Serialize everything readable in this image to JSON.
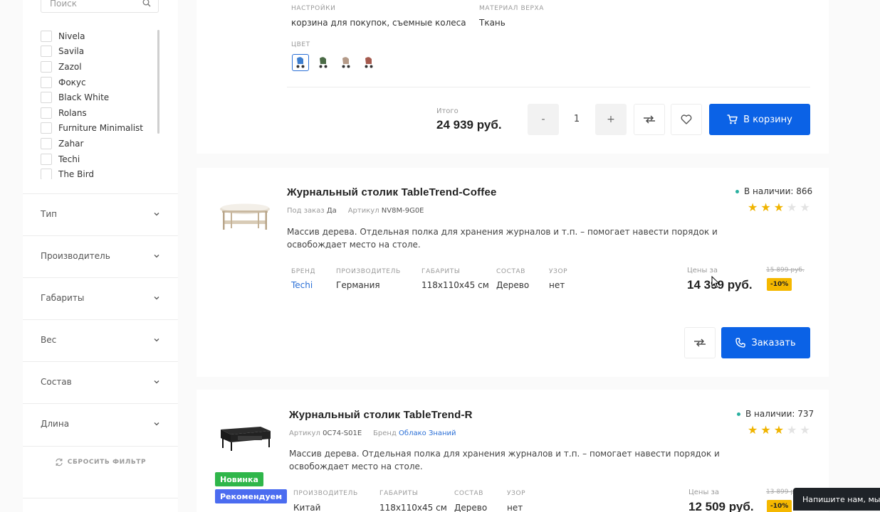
{
  "sidebar": {
    "search": {
      "placeholder": "Поиск"
    },
    "brands": [
      "Nivela",
      "Savila",
      "Zazol",
      "Фокус",
      "Black White",
      "Rolans",
      "Furniture Minimalist",
      "Zahar",
      "Techi",
      "The Bird"
    ],
    "filters": [
      "Тип",
      "Производитель",
      "Габариты",
      "Вес",
      "Состав",
      "Длина"
    ],
    "reset_label": "СБРОСИТЬ ФИЛЬТР"
  },
  "top_card": {
    "settings_label": "НАСТРОЙКИ",
    "settings_value": "корзина для покупок, съемные колеса",
    "material_label": "МАТЕРИАЛ ВЕРХА",
    "material_value": "Ткань",
    "color_label": "ЦВЕТ",
    "total_label": "Итого",
    "total_value": "24 939 руб.",
    "qty_minus": "-",
    "qty_value": "1",
    "qty_plus": "+",
    "cart_label": "В корзину"
  },
  "product1": {
    "title": "Журнальный столик TableTrend-Coffee",
    "order_label": "Под заказ",
    "order_value": "Да",
    "article_label": "Артикул",
    "article_value": "NV8M-9G0E",
    "stock": "В наличии: 866",
    "rating": 3,
    "description": "Массив дерева. Отдельная полка для хранения журналов и т.п. – помогает навести порядок и освобождает место на столе.",
    "props": [
      {
        "label": "БРЕНД",
        "value": "Techi"
      },
      {
        "label": "ПРОИЗВОДИТЕЛЬ",
        "value": "Германия"
      },
      {
        "label": "ГАБАРИТЫ",
        "value": "118x110x45 см"
      },
      {
        "label": "СОСТАВ",
        "value": "Дерево"
      },
      {
        "label": "УЗОР",
        "value": "нет"
      }
    ],
    "price_label": "Цены за",
    "price": "14 399 руб.",
    "old_price": "15 899 руб.",
    "discount": "-10%",
    "order_button": "Заказать"
  },
  "product2": {
    "title": "Журнальный столик TableTrend-R",
    "article_label": "Артикул",
    "article_value": "0C74-S01E",
    "brand_label": "Бренд",
    "brand_value": "Облако Знаний",
    "stock": "В наличии: 737",
    "rating": 3,
    "description": "Массив дерева. Отдельная полка для хранения журналов и т.п. – помогает навести порядок и освобождает место на столе.",
    "badges": [
      "Новинка",
      "Рекомендуем"
    ],
    "props": [
      {
        "label": "ПРОИЗВОДИТЕЛЬ",
        "value": "Китай"
      },
      {
        "label": "ГАБАРИТЫ",
        "value": "118x110x45 см"
      },
      {
        "label": "СОСТАВ",
        "value": "Дерево"
      },
      {
        "label": "УЗОР",
        "value": "нет"
      }
    ],
    "price_label": "Цены за",
    "price": "12 509 руб.",
    "old_price": "13 899 руб.",
    "discount": "-10%"
  },
  "chat": {
    "label": "Напишите нам, мы о"
  },
  "colors": {
    "accent": "#0b62e6",
    "discount": "#f5b800",
    "badge_new": "#2fb64a",
    "badge_recommend": "#4b6cf0",
    "star_on": "#f0b400",
    "stock_dot": "#2ab0a0"
  }
}
